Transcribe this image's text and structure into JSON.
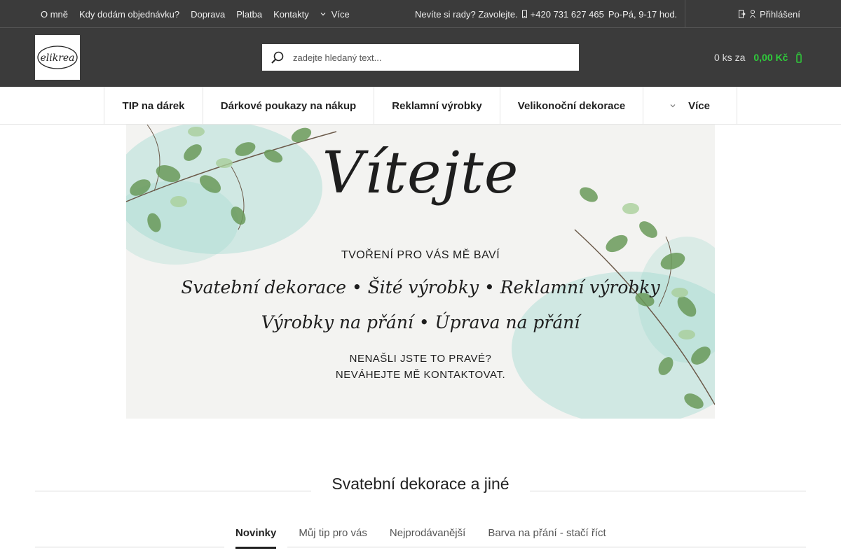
{
  "topbar": {
    "links": [
      "O mně",
      "Kdy dodám objednávku?",
      "Doprava",
      "Platba",
      "Kontakty"
    ],
    "more_label": "Více",
    "contact_text": "Nevíte si rady? Zavolejte.",
    "phone": "+420 731 627 465",
    "hours": "Po-Pá, 9-17 hod.",
    "login_label": "Přihlášení"
  },
  "header": {
    "logo_text": "elikrea",
    "search_placeholder": "zadejte hledaný text...",
    "cart_count": "0 ks za",
    "cart_price": "0,00 Kč"
  },
  "categories": {
    "items": [
      "TIP na dárek",
      "Dárkové poukazy na nákup",
      "Reklamní výrobky",
      "Velikonoční dekorace"
    ],
    "more_label": "Více"
  },
  "banner": {
    "title": "Vítejte",
    "subtitle": "TVOŘENÍ PRO VÁS MĚ BAVÍ",
    "line1": "Svatební dekorace  •  Šité výrobky  •  Reklamní výrobky",
    "line2": "Výrobky na přání  •  Úprava na přání",
    "cta1": "NENAŠLI JSTE TO PRAVÉ?",
    "cta2": "NEVÁHEJTE MĚ KONTAKTOVAT."
  },
  "section": {
    "title": "Svatební dekorace a jiné"
  },
  "tabs": [
    "Novinky",
    "Můj tip pro vás",
    "Nejprodávanější",
    "Barva na přání - stačí říct"
  ],
  "colors": {
    "dark_bg": "#3b3b3b",
    "price_green": "#2fcb3b",
    "leaf_green": "#6a9a5a",
    "watercolor": "#8fd3c8"
  }
}
